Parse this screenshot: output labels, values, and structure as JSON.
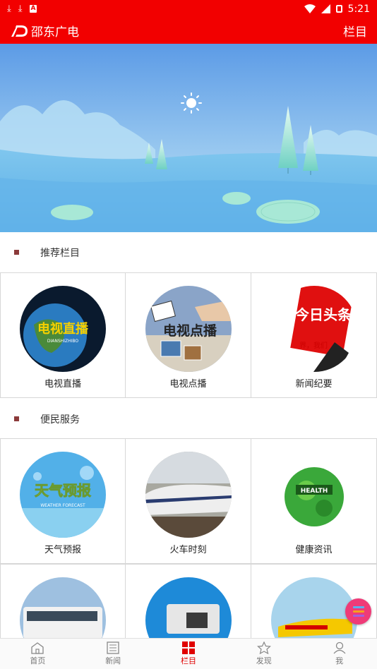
{
  "status_bar": {
    "time": "5:21",
    "left_icons": [
      "download-icon",
      "download-icon",
      "notification-a-icon"
    ],
    "right_icons": [
      "wifi-icon",
      "signal-icon",
      "battery-icon"
    ]
  },
  "header": {
    "title": "邵东广电",
    "menu_label": "栏目",
    "brand_color": "#f20000"
  },
  "sections": [
    {
      "title": "推荐栏目",
      "items": [
        {
          "label": "电视直播",
          "thumb_text": "电视直播",
          "thumb_sub": "DIANSHIZHIBO"
        },
        {
          "label": "电视点播",
          "thumb_text": "电视点播"
        },
        {
          "label": "新闻纪要",
          "thumb_text": "今日头条",
          "thumb_sub": "界，我们"
        }
      ]
    },
    {
      "title": "便民服务",
      "items": [
        {
          "label": "天气预报",
          "thumb_text": "天气预报",
          "thumb_sub": "WEATHER FORECAST"
        },
        {
          "label": "火车时刻"
        },
        {
          "label": "健康资讯",
          "thumb_text": "HEALTH"
        },
        {
          "label": ""
        },
        {
          "label": ""
        },
        {
          "label": ""
        }
      ]
    }
  ],
  "bottom_nav": [
    {
      "label": "首页",
      "icon": "home-icon",
      "active": false
    },
    {
      "label": "新闻",
      "icon": "news-icon",
      "active": false
    },
    {
      "label": "栏目",
      "icon": "grid-icon",
      "active": true
    },
    {
      "label": "发现",
      "icon": "discover-icon",
      "active": false
    },
    {
      "label": "我",
      "icon": "user-icon",
      "active": false
    }
  ]
}
